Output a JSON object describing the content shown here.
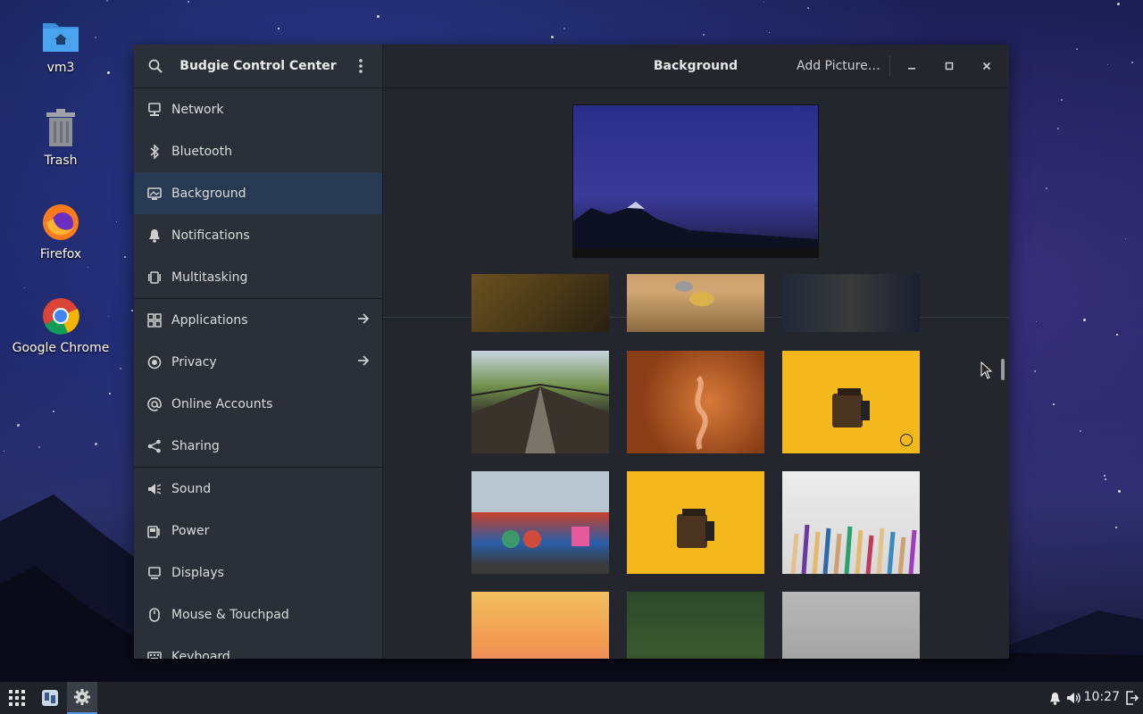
{
  "desktop": {
    "icons": [
      {
        "label": "vm3"
      },
      {
        "label": "Trash"
      },
      {
        "label": "Firefox"
      },
      {
        "label": "Google Chrome"
      }
    ]
  },
  "window": {
    "sidebar_title": "Budgie Control Center",
    "main_title": "Background",
    "add_picture": "Add Picture…"
  },
  "sidebar": {
    "items": [
      {
        "label": "Network",
        "icon": "network-icon"
      },
      {
        "label": "Bluetooth",
        "icon": "bluetooth-icon"
      },
      {
        "label": "Background",
        "icon": "background-icon",
        "active": true
      },
      {
        "label": "Notifications",
        "icon": "bell-icon"
      },
      {
        "label": "Multitasking",
        "icon": "multitasking-icon"
      },
      {
        "label": "Applications",
        "icon": "applications-icon",
        "arrow": true
      },
      {
        "label": "Privacy",
        "icon": "privacy-icon",
        "arrow": true
      },
      {
        "label": "Online Accounts",
        "icon": "at-icon"
      },
      {
        "label": "Sharing",
        "icon": "share-icon"
      },
      {
        "label": "Sound",
        "icon": "speaker-icon"
      },
      {
        "label": "Power",
        "icon": "power-icon"
      },
      {
        "label": "Displays",
        "icon": "display-icon"
      },
      {
        "label": "Mouse & Touchpad",
        "icon": "mouse-icon"
      },
      {
        "label": "Keyboard",
        "icon": "keyboard-icon"
      }
    ]
  },
  "taskbar": {
    "clock": "10:27"
  },
  "colors": {
    "accent_active": "#273a52",
    "sidebar_bg": "#2b2f38",
    "window_bg": "#23262d"
  }
}
